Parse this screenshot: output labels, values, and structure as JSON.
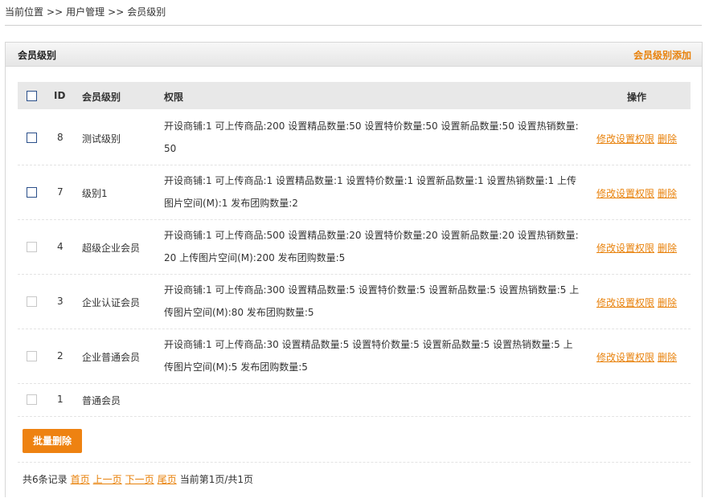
{
  "breadcrumb": {
    "items": [
      "当前位置",
      "用户管理",
      "会员级别"
    ],
    "separator": ">>"
  },
  "panel": {
    "title": "会员级别",
    "add_link": "会员级别添加"
  },
  "table": {
    "headers": {
      "id": "ID",
      "level": "会员级别",
      "perm": "权限",
      "ops": "操作"
    },
    "rows": [
      {
        "id": "8",
        "name": "测试级别",
        "perm": "开设商铺:1 可上传商品:200 设置精品数量:50 设置特价数量:50 设置新品数量:50 设置热销数量:50",
        "edit": "修改设置权限",
        "del": "删除"
      },
      {
        "id": "7",
        "name": "级别1",
        "perm": "开设商铺:1 可上传商品:1 设置精品数量:1 设置特价数量:1 设置新品数量:1 设置热销数量:1 上传图片空间(M):1 发布团购数量:2",
        "edit": "修改设置权限",
        "del": "删除"
      },
      {
        "id": "4",
        "name": "超级企业会员",
        "perm": "开设商铺:1 可上传商品:500 设置精品数量:20 设置特价数量:20 设置新品数量:20 设置热销数量:20 上传图片空间(M):200 发布团购数量:5",
        "edit": "修改设置权限",
        "del": "删除"
      },
      {
        "id": "3",
        "name": "企业认证会员",
        "perm": "开设商铺:1 可上传商品:300 设置精品数量:5 设置特价数量:5 设置新品数量:5 设置热销数量:5 上传图片空间(M):80 发布团购数量:5",
        "edit": "修改设置权限",
        "del": "删除"
      },
      {
        "id": "2",
        "name": "企业普通会员",
        "perm": "开设商铺:1 可上传商品:30 设置精品数量:5 设置特价数量:5 设置新品数量:5 设置热销数量:5 上传图片空间(M):5 发布团购数量:5",
        "edit": "修改设置权限",
        "del": "删除"
      },
      {
        "id": "1",
        "name": "普通会员",
        "perm": "",
        "edit": "",
        "del": ""
      }
    ]
  },
  "batch_delete": "批量删除",
  "pager": {
    "summary": "共6条记录",
    "first": "首页",
    "prev": "上一页",
    "next": "下一页",
    "last": "尾页",
    "current": "当前第1页/共1页"
  },
  "colors": {
    "accent": "#ee8211",
    "link": "#e8810a",
    "checkbox_active": "#2a4f8a"
  }
}
